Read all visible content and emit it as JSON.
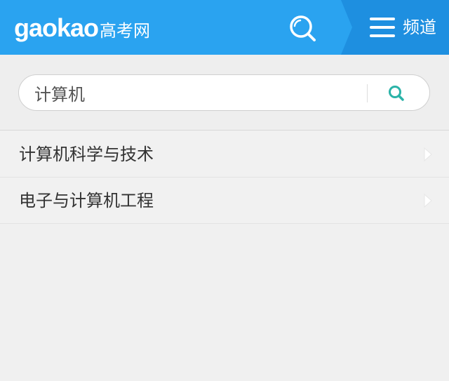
{
  "header": {
    "logo_word": "gaokao",
    "logo_cn": "高考网",
    "search_icon": "search-icon",
    "menu_icon": "hamburger-menu-icon",
    "menu_label": "频道"
  },
  "search": {
    "value": "计算机",
    "placeholder": "",
    "submit_icon": "search-icon"
  },
  "results": [
    {
      "label": "计算机科学与技术",
      "icon": "chevron-right-icon"
    },
    {
      "label": "电子与计算机工程",
      "icon": "chevron-right-icon"
    }
  ],
  "colors": {
    "header_bg": "#2aa3f0",
    "channel_bg": "#1e8fe0",
    "search_icon_accent": "#2bb3a8",
    "page_bg": "#f0f0f0"
  }
}
